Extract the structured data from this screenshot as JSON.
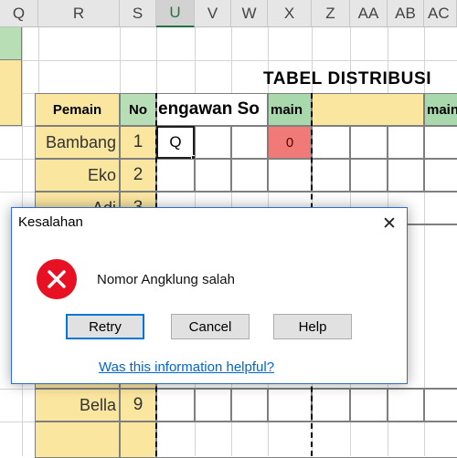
{
  "spreadsheet": {
    "column_headers": [
      "Q",
      "R",
      "S",
      "U",
      "V",
      "W",
      "X",
      "Z",
      "AA",
      "AB",
      "AC"
    ],
    "title": "TABEL DISTRIBUSI",
    "header_row": {
      "pemain": "Pemain",
      "no": "No",
      "pengawan": "engawan So",
      "main1": "main",
      "main2": "main"
    },
    "rows": [
      {
        "name": "Bambang",
        "no": "1",
        "cell_u": "Q",
        "cell_x": "0"
      },
      {
        "name": "Eko",
        "no": "2"
      },
      {
        "name": "Adi",
        "no": "3"
      },
      {
        "name": "Bella",
        "no": "9"
      }
    ],
    "colors": {
      "yellow": "#fbe6a0",
      "green": "#b7deb5",
      "red": "#ef7a78",
      "selected_header_accent": "#217346"
    }
  },
  "dialog": {
    "title": "Kesalahan",
    "message": "Nomor Angklung salah",
    "buttons": {
      "retry": "Retry",
      "cancel": "Cancel",
      "help": "Help"
    },
    "link": "Was this information helpful?",
    "close_glyph": "✕",
    "icon": "error-icon",
    "colors": {
      "error": "#e81123",
      "link": "#0066cc",
      "accent": "#0078d7"
    }
  }
}
